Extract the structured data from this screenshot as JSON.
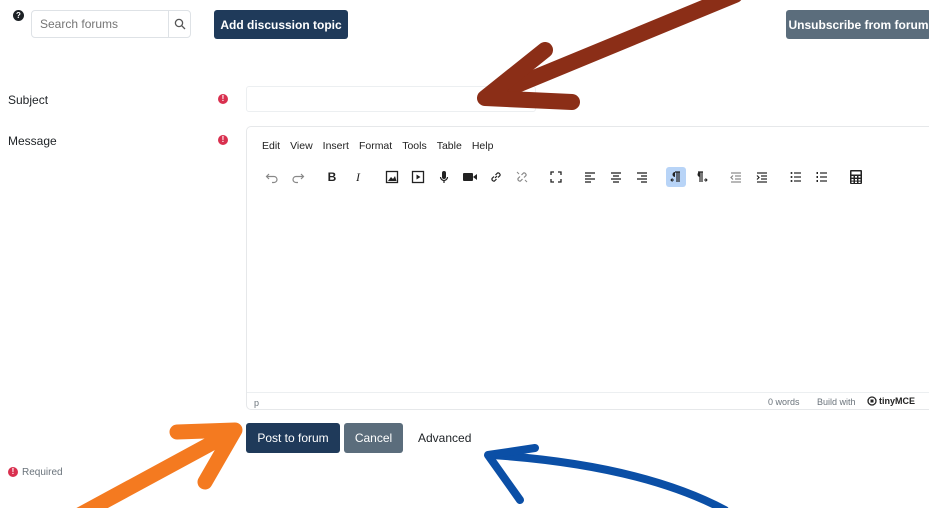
{
  "topbar": {
    "search_placeholder": "Search forums",
    "add_topic_label": "Add discussion topic",
    "unsubscribe_label": "Unsubscribe from forum"
  },
  "form": {
    "subject_label": "Subject",
    "message_label": "Message"
  },
  "editor": {
    "menu": [
      "Edit",
      "View",
      "Insert",
      "Format",
      "Tools",
      "Table",
      "Help"
    ],
    "status_path": "p",
    "word_count": "0 words",
    "build_with": "Build with",
    "brand": "tinyMCE"
  },
  "actions": {
    "post_label": "Post to forum",
    "cancel_label": "Cancel",
    "advanced_label": "Advanced"
  },
  "footer": {
    "required_label": "Required"
  },
  "colors": {
    "primary_button": "#1f3a5a",
    "secondary_button": "#5b6d7c",
    "required_icon": "#d9304f",
    "arrow_brown": "#8b2e17",
    "arrow_orange": "#f47a20",
    "arrow_blue": "#0b4fa6"
  }
}
